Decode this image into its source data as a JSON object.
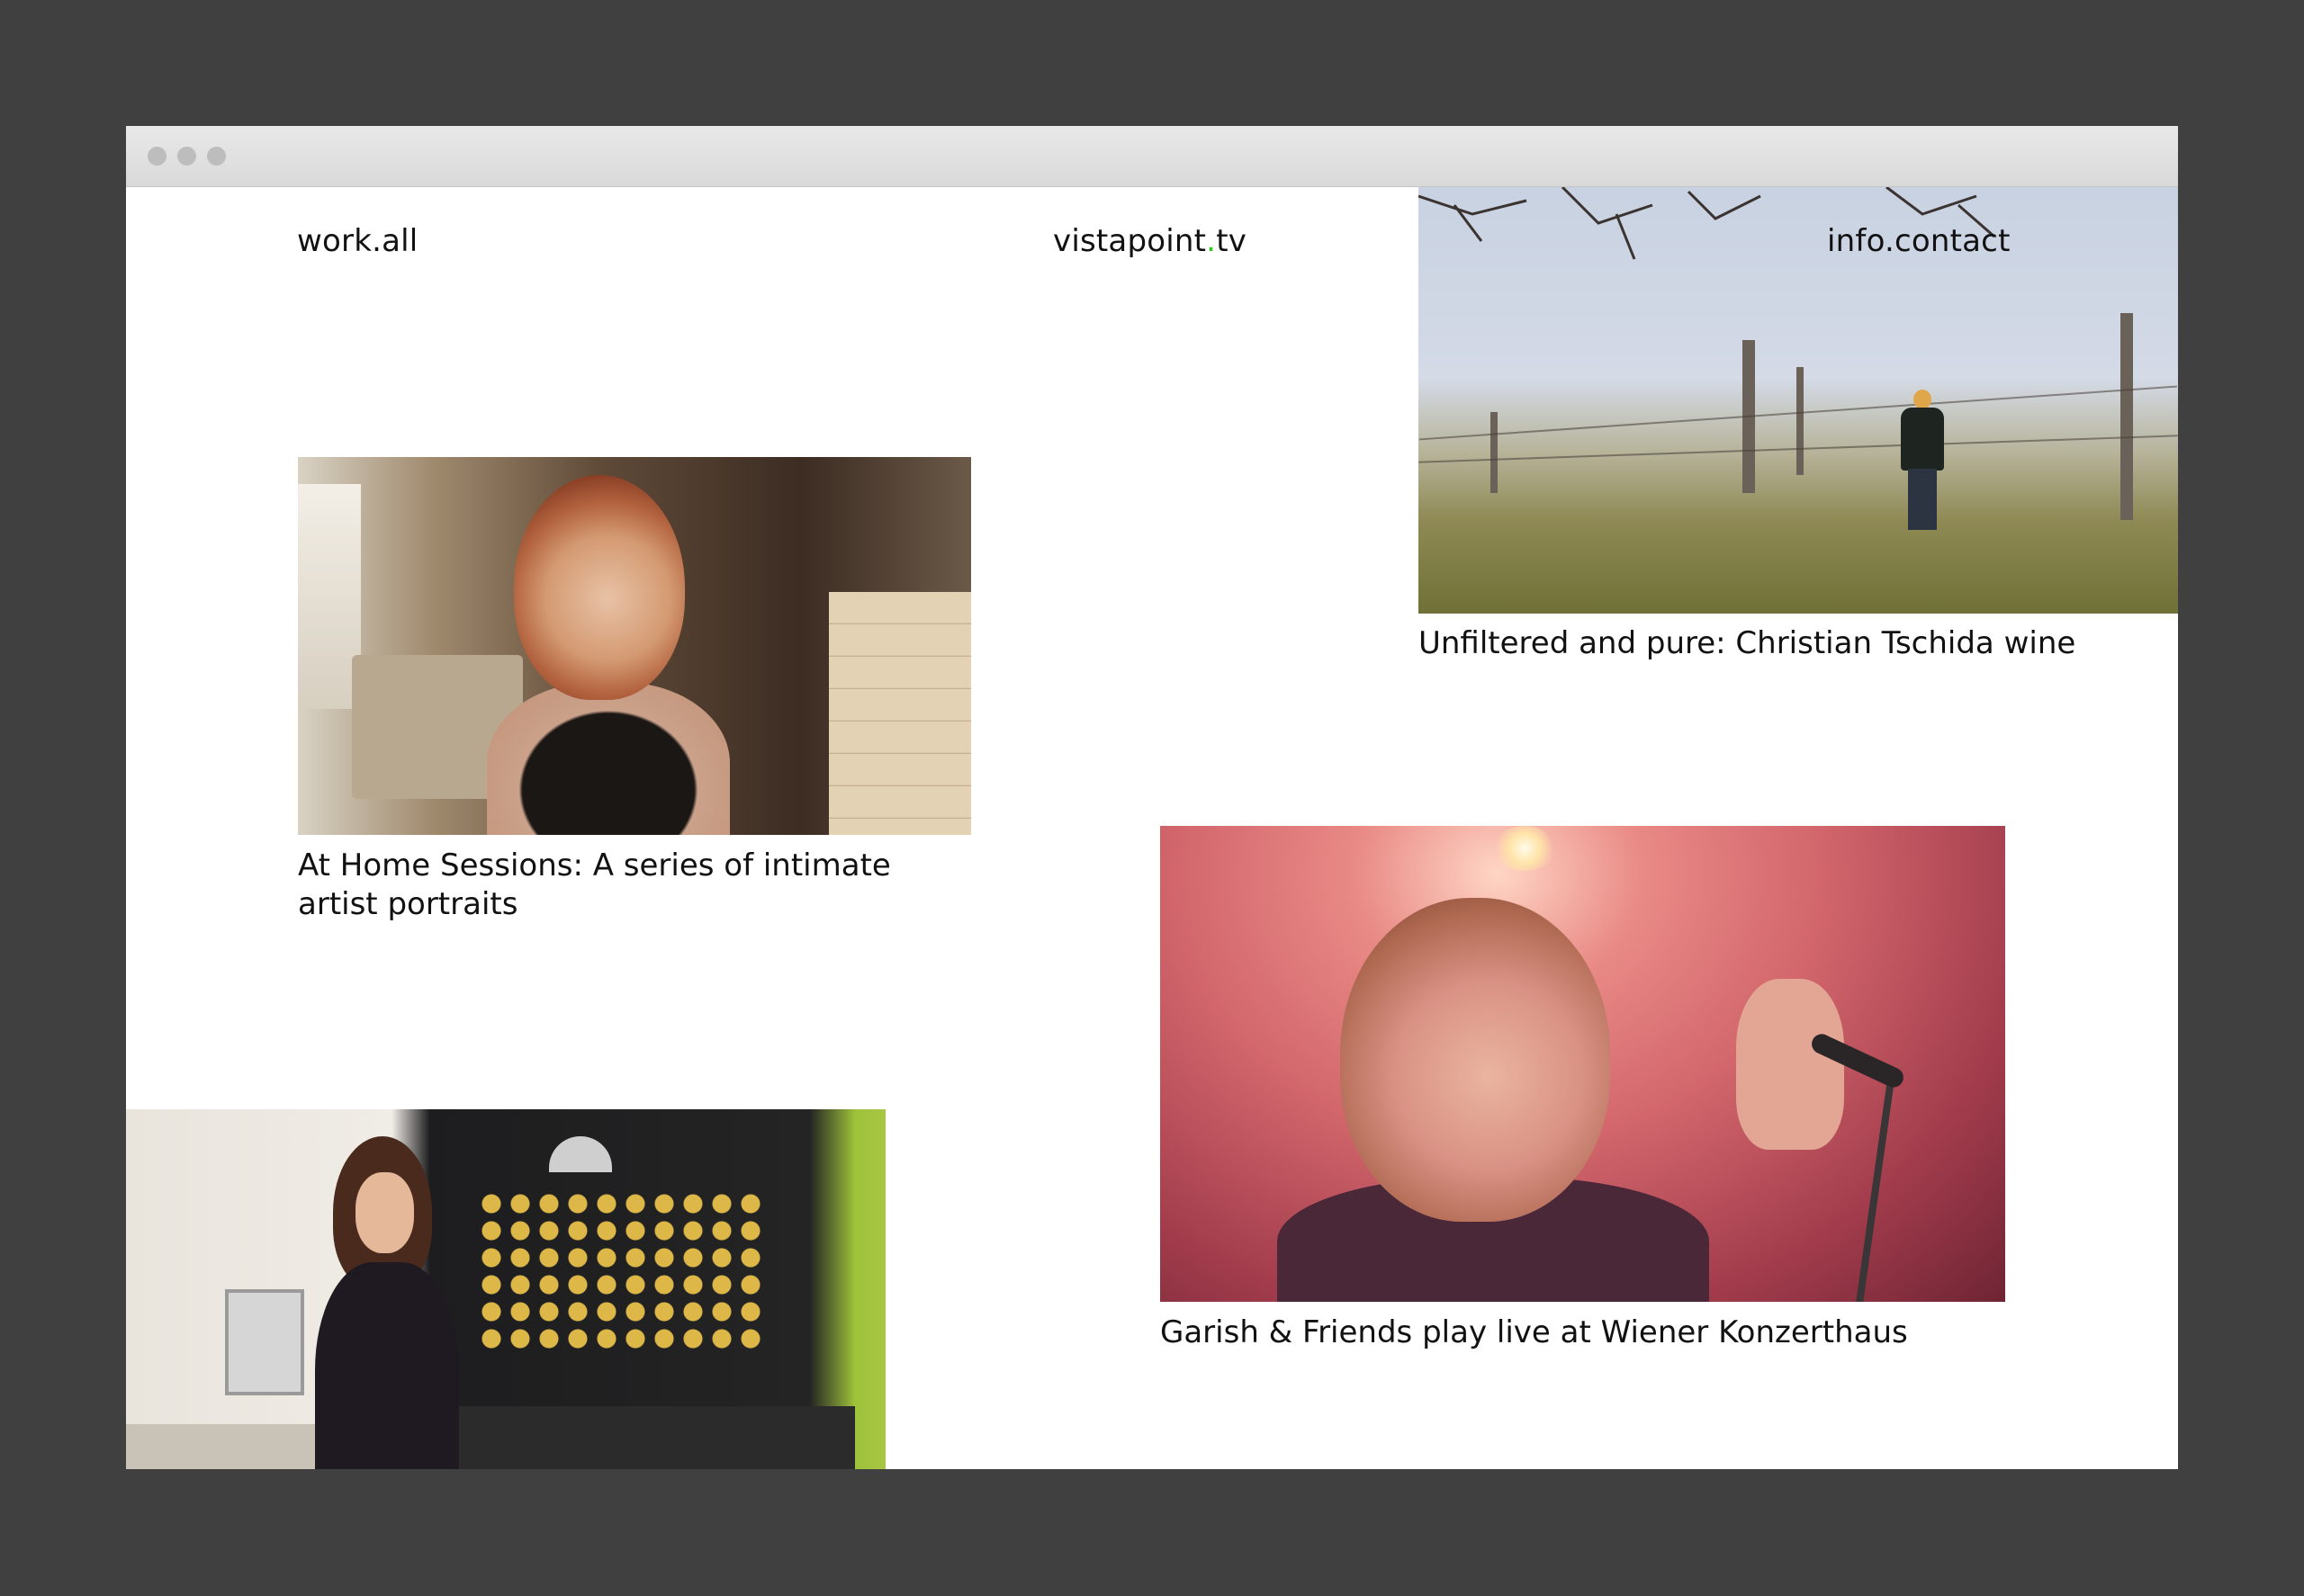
{
  "nav": {
    "work_label": "work.all",
    "logo_main": "vistapoint",
    "logo_dot": ".",
    "logo_tld": "tv",
    "info_label": "info.contact"
  },
  "projects": [
    {
      "title": "Unfiltered and pure: Christian Tschida wine"
    },
    {
      "title": "At Home Sessions: A series of intimate artist portraits"
    },
    {
      "title": "Garish & Friends play live at Wiener Konzerthaus"
    }
  ],
  "colors": {
    "page_background": "#404040",
    "window_background": "#ffffff",
    "logo_accent": "#2ecc1a",
    "text": "#111111"
  }
}
